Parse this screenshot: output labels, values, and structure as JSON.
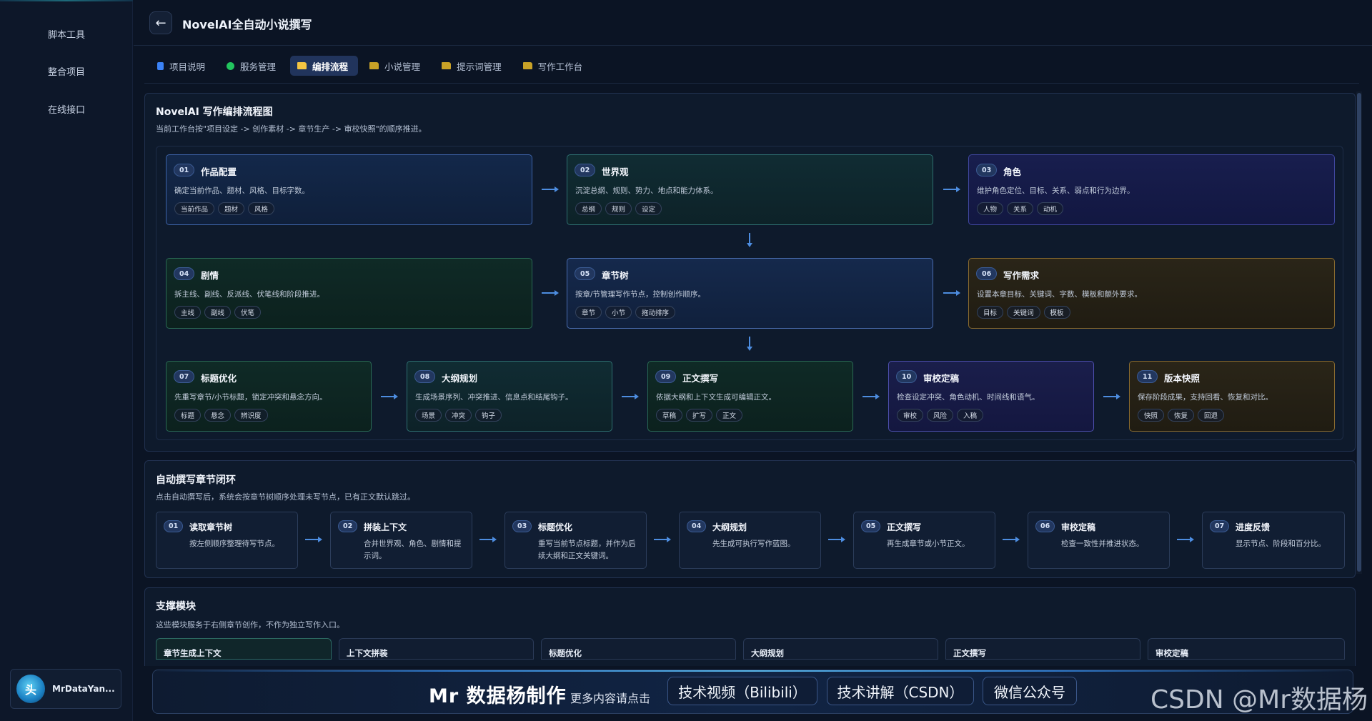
{
  "sidebar": {
    "items": [
      {
        "label": "脚本工具"
      },
      {
        "label": "整合项目"
      },
      {
        "label": "在线接口"
      }
    ],
    "user": {
      "avatar_text": "头",
      "name": "MrDataYan..."
    }
  },
  "header": {
    "back_icon": "←",
    "title": "NovelAI全自动小说撰写"
  },
  "tabs": [
    {
      "label": "项目说明",
      "icon": "document-icon",
      "color": "#3b82f6",
      "active": false
    },
    {
      "label": "服务管理",
      "icon": "status-dot-icon",
      "color": "#22c55e",
      "active": false
    },
    {
      "label": "编排流程",
      "icon": "folder-icon",
      "color": "#f5c542",
      "active": true
    },
    {
      "label": "小说管理",
      "icon": "folder-icon",
      "color": "#c9a227",
      "active": false
    },
    {
      "label": "提示词管理",
      "icon": "folder-icon",
      "color": "#c9a227",
      "active": false
    },
    {
      "label": "写作工作台",
      "icon": "folder-icon",
      "color": "#c9a227",
      "active": false
    }
  ],
  "flow": {
    "title": "NovelAI 写作编排流程图",
    "desc": "当前工作台按\"项目设定 -> 创作素材 -> 章节生产 -> 审校快照\"的顺序推进。",
    "cards": [
      {
        "num": "01",
        "title": "作品配置",
        "desc": "确定当前作品、题材、风格、目标字数。",
        "tags": [
          "当前作品",
          "题材",
          "风格"
        ]
      },
      {
        "num": "02",
        "title": "世界观",
        "desc": "沉淀总纲、规则、势力、地点和能力体系。",
        "tags": [
          "总纲",
          "规则",
          "设定"
        ]
      },
      {
        "num": "03",
        "title": "角色",
        "desc": "维护角色定位、目标、关系、弱点和行为边界。",
        "tags": [
          "人物",
          "关系",
          "动机"
        ]
      },
      {
        "num": "04",
        "title": "剧情",
        "desc": "拆主线、副线、反派线、伏笔线和阶段推进。",
        "tags": [
          "主线",
          "副线",
          "伏笔"
        ]
      },
      {
        "num": "05",
        "title": "章节树",
        "desc": "按章/节管理写作节点，控制创作顺序。",
        "tags": [
          "章节",
          "小节",
          "拖动排序"
        ]
      },
      {
        "num": "06",
        "title": "写作需求",
        "desc": "设置本章目标、关键词、字数、模板和额外要求。",
        "tags": [
          "目标",
          "关键词",
          "模板"
        ]
      },
      {
        "num": "07",
        "title": "标题优化",
        "desc": "先重写章节/小节标题，锁定冲突和悬念方向。",
        "tags": [
          "标题",
          "悬念",
          "辨识度"
        ]
      },
      {
        "num": "08",
        "title": "大纲规划",
        "desc": "生成场景序列、冲突推进、信息点和结尾钩子。",
        "tags": [
          "场景",
          "冲突",
          "钩子"
        ]
      },
      {
        "num": "09",
        "title": "正文撰写",
        "desc": "依据大纲和上下文生成可编辑正文。",
        "tags": [
          "草稿",
          "扩写",
          "正文"
        ]
      },
      {
        "num": "10",
        "title": "审校定稿",
        "desc": "检查设定冲突、角色动机、时间线和语气。",
        "tags": [
          "审校",
          "风险",
          "入稿"
        ]
      },
      {
        "num": "11",
        "title": "版本快照",
        "desc": "保存阶段成果，支持回看、恢复和对比。",
        "tags": [
          "快照",
          "恢复",
          "回退"
        ]
      }
    ]
  },
  "loop": {
    "title": "自动撰写章节闭环",
    "desc": "点击自动撰写后，系统会按章节树顺序处理未写节点，已有正文默认跳过。",
    "steps": [
      {
        "num": "01",
        "title": "读取章节树",
        "desc": "按左侧顺序整理待写节点。"
      },
      {
        "num": "02",
        "title": "拼装上下文",
        "desc": "合并世界观、角色、剧情和提示词。"
      },
      {
        "num": "03",
        "title": "标题优化",
        "desc": "重写当前节点标题，并作为后续大纲和正文关键词。"
      },
      {
        "num": "04",
        "title": "大纲规划",
        "desc": "先生成可执行写作蓝图。"
      },
      {
        "num": "05",
        "title": "正文撰写",
        "desc": "再生成章节或小节正文。"
      },
      {
        "num": "06",
        "title": "审校定稿",
        "desc": "检查一致性并推进状态。"
      },
      {
        "num": "07",
        "title": "进度反馈",
        "desc": "显示节点、阶段和百分比。"
      }
    ]
  },
  "support": {
    "title": "支撑模块",
    "desc": "这些模块服务于右侧章节创作，不作为独立写作入口。",
    "modules": [
      {
        "title": "章节生成上下文"
      },
      {
        "title": "上下文拼装"
      },
      {
        "title": "标题优化"
      },
      {
        "title": "大纲规划"
      },
      {
        "title": "正文撰写"
      },
      {
        "title": "审校定稿"
      }
    ]
  },
  "banner": {
    "title": "Mr 数据杨制作",
    "subtitle": "更多内容请点击",
    "buttons": [
      {
        "label": "技术视频（Bilibili）"
      },
      {
        "label": "技术讲解（CSDN）"
      },
      {
        "label": "微信公众号"
      }
    ]
  },
  "watermark": "CSDN @Mr数据杨"
}
